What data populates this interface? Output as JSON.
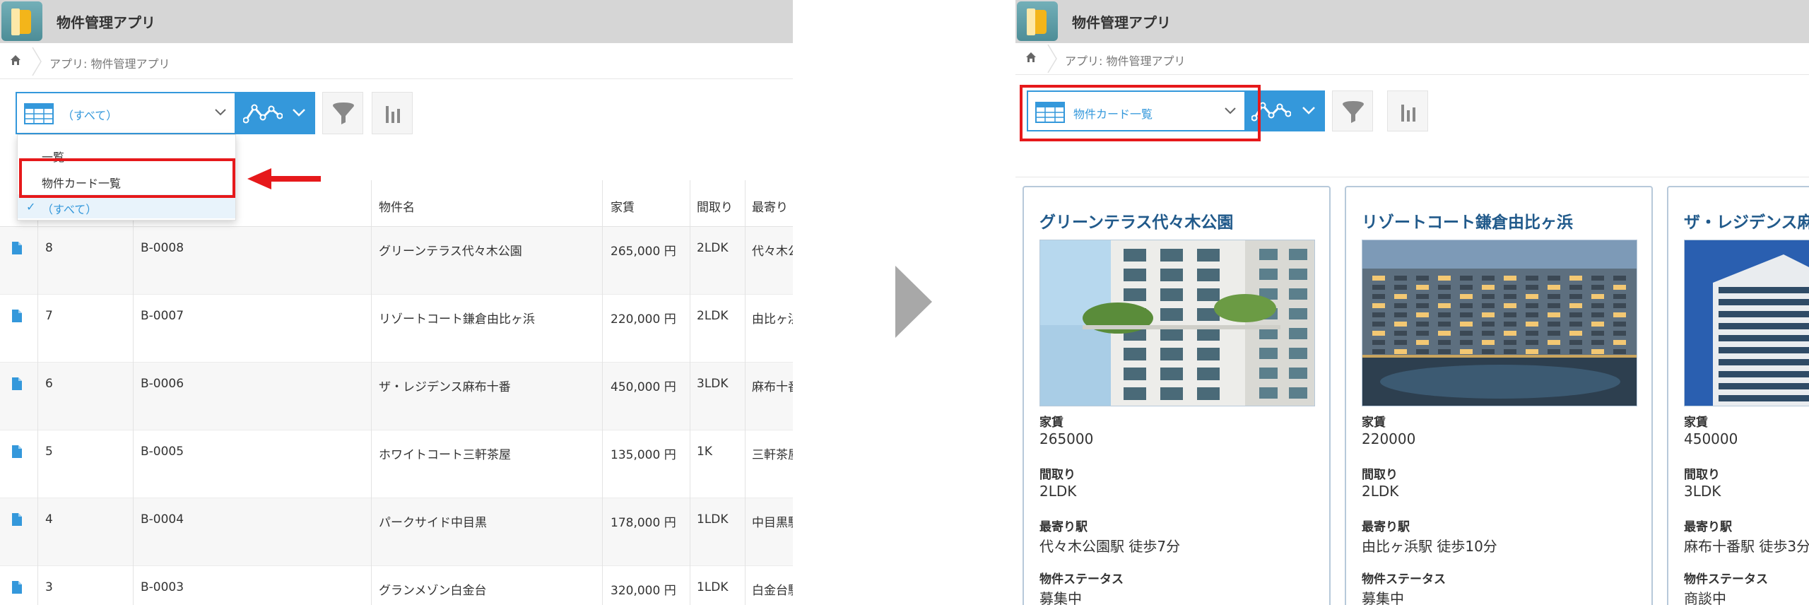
{
  "app_title": "物件管理アプリ",
  "breadcrumb": "アプリ: 物件管理アプリ",
  "colors": {
    "accent": "#3498db",
    "highlight": "#e6191b",
    "card_title": "#215a8b"
  },
  "left": {
    "view_select_label": "（すべて）",
    "dropdown_options": [
      "一覧",
      "物件カード一覧",
      "（すべて）"
    ],
    "selected_option": "（すべて）",
    "table": {
      "headers": [
        "物件名",
        "家賃",
        "間取り",
        "最寄り"
      ],
      "rows": [
        {
          "no": "8",
          "code": "B-0008",
          "name": "グリーンテラス代々木公園",
          "rent": "265,000 円",
          "layout": "2LDK",
          "station": "代々木公"
        },
        {
          "no": "7",
          "code": "B-0007",
          "name": "リゾートコート鎌倉由比ヶ浜",
          "rent": "220,000 円",
          "layout": "2LDK",
          "station": "由比ヶ浜"
        },
        {
          "no": "6",
          "code": "B-0006",
          "name": "ザ・レジデンス麻布十番",
          "rent": "450,000 円",
          "layout": "3LDK",
          "station": "麻布十番"
        },
        {
          "no": "5",
          "code": "B-0005",
          "name": "ホワイトコート三軒茶屋",
          "rent": "135,000 円",
          "layout": "1K",
          "station": "三軒茶屋"
        },
        {
          "no": "4",
          "code": "B-0004",
          "name": "パークサイド中目黒",
          "rent": "178,000 円",
          "layout": "1LDK",
          "station": "中目黒駅"
        },
        {
          "no": "3",
          "code": "B-0003",
          "name": "グランメゾン白金台",
          "rent": "320,000 円",
          "layout": "1LDK",
          "station": "白金台駅"
        }
      ]
    }
  },
  "right": {
    "view_select_label": "物件カード一覧",
    "field_labels": {
      "rent": "家賃",
      "layout": "間取り",
      "station": "最寄り駅",
      "status": "物件ステータス"
    },
    "cards": [
      {
        "title": "グリーンテラス代々木公園",
        "rent": "265000",
        "layout": "2LDK",
        "station": "代々木公園駅 徒歩7分",
        "status": "募集中",
        "photo_icon": "white-apartment-tower-photo"
      },
      {
        "title": "リゾートコート鎌倉由比ヶ浜",
        "rent": "220000",
        "layout": "2LDK",
        "station": "由比ヶ浜駅 徒歩10分",
        "status": "募集中",
        "photo_icon": "resort-condo-pool-photo"
      },
      {
        "title": "ザ・レジデンス麻布十番",
        "rent": "450000",
        "layout": "3LDK",
        "station": "麻布十番駅 徒歩3分",
        "status": "商談中",
        "photo_icon": "modern-residence-tower-photo"
      }
    ]
  }
}
